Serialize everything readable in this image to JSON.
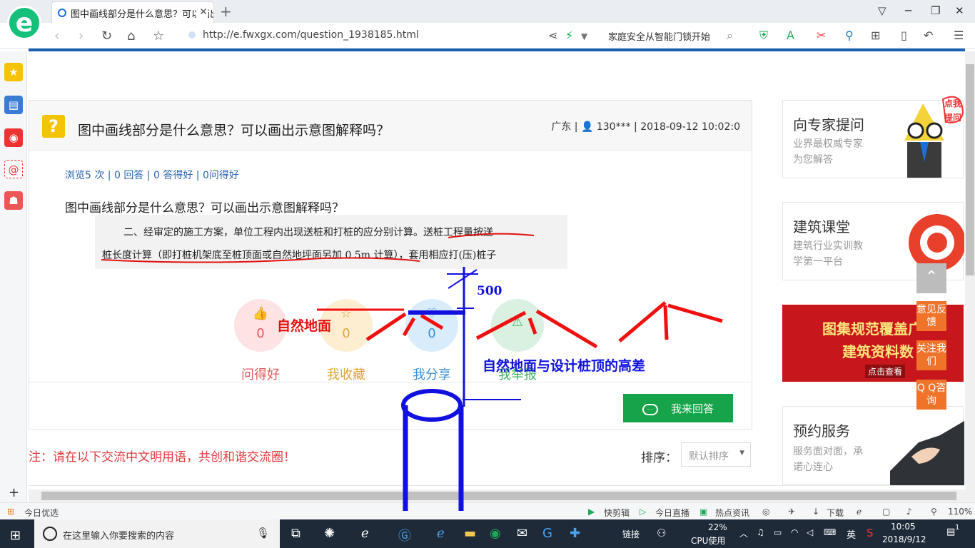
{
  "browser": {
    "tab_title": "图中画线部分是什么意思？可以画出示意图解释吗？",
    "url": "http://e.fwxgx.com/question_1938185.html",
    "promo_text": "家庭安全从智能门锁开始",
    "logo_letter": "e"
  },
  "question": {
    "title": "图中画线部分是什么意思？可以画出示意图解释吗？",
    "region": "广东",
    "user": "130***",
    "datetime": "2018-09-12 10:02:0",
    "stats": {
      "views": "浏览5 次",
      "answers": "0 回答",
      "good_answers": "0 答得好",
      "helpful": "0问得好"
    },
    "body": "图中画线部分是什么意思？可以画出示意图解释吗？",
    "excerpt_line1_plain": "二、经审定的施工方案，单位工程内出现送桩和打桩的应分别计算。",
    "excerpt_line1_marked": "送桩工程量按送",
    "excerpt_line2_marked": "桩长度计算（即打桩机架底至桩顶面或自然地坪面另加 0.5m 计算）",
    "excerpt_line2_plain": "，套用相应打(压)桩子"
  },
  "actions": [
    {
      "label": "问得好",
      "count": "0",
      "icon": "thumbs-up-icon",
      "color": "#e05a5a",
      "bg": "#fde3e3"
    },
    {
      "label": "我收藏",
      "count": "0",
      "icon": "star-icon",
      "color": "#e0a43a",
      "bg": "#fdeed2"
    },
    {
      "label": "我分享",
      "count": "0",
      "icon": "share-icon",
      "color": "#3a8fd6",
      "bg": "#d9ecfb"
    },
    {
      "label": "我举报",
      "count": "",
      "icon": "warning-icon",
      "color": "#3fae64",
      "bg": "#daf1e1"
    }
  ],
  "answer_button": "我来回答",
  "notice": "注：请在以下交流中文明用语，共创和谐交流圈！",
  "sort": {
    "label": "排序：",
    "value": "默认排序"
  },
  "sidebar_cards": [
    {
      "title": "向专家提问",
      "sub": [
        "业界最权威专家",
        "为您解答"
      ]
    },
    {
      "title": "建筑课堂",
      "sub": [
        "建筑行业实训教",
        "学第一平台"
      ]
    },
    {
      "title": "预约服务",
      "sub": [
        "服务面对面，承",
        "诺心连心"
      ]
    }
  ],
  "mascot_bubble": [
    "点我",
    "提问"
  ],
  "banner": {
    "line1": "图集规范覆盖广",
    "line2": "建筑资料数",
    "cta": "点击查看"
  },
  "float_buttons": [
    "意见反馈",
    "关注我们",
    "Q Q咨询"
  ],
  "annotations": {
    "ground_label": "自然地面",
    "height_value": "500",
    "diff_label": "自然地面与设计桩顶的高差"
  },
  "statusbar": {
    "left": "今日优选",
    "items": [
      "快剪辑",
      "今日直播",
      "热点资讯",
      "下载"
    ],
    "zoom": "110%"
  },
  "taskbar": {
    "search_placeholder": "在这里输入你要搜索的内容",
    "links_label": "链接",
    "cpu_value": "22%",
    "cpu_label": "CPU使用",
    "ime": "英",
    "time": "10:05",
    "date": "2018/9/12",
    "notifications": "1"
  },
  "colors": {
    "accent_blue": "#1a5fb4",
    "answer_green": "#17a349",
    "notice_red": "#e0393e",
    "float_orange": "#f0732a"
  }
}
